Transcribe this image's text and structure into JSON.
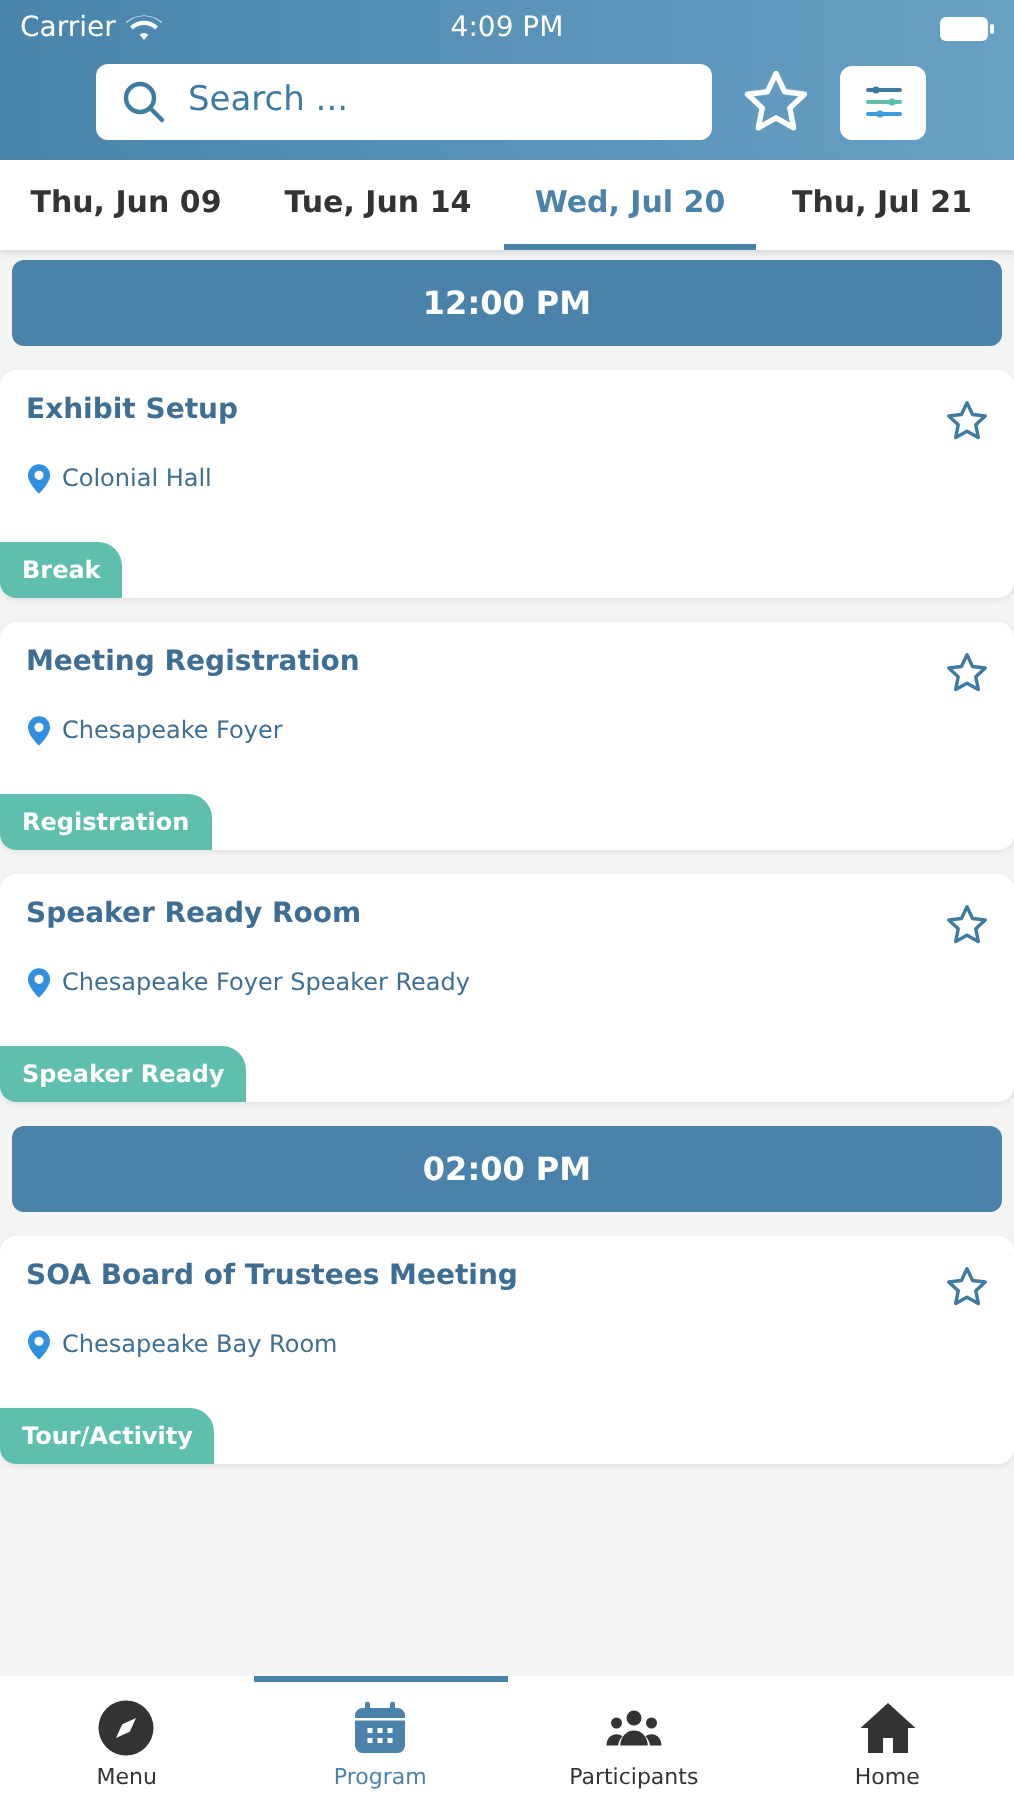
{
  "status_bar": {
    "carrier": "Carrier",
    "time": "4:09 PM"
  },
  "search": {
    "placeholder": "Search ..."
  },
  "tabs": [
    {
      "label": "Thu, Jun 09",
      "selected": false
    },
    {
      "label": "Tue, Jun 14",
      "selected": false
    },
    {
      "label": "Wed, Jul 20",
      "selected": true
    },
    {
      "label": "Thu, Jul 21",
      "selected": false
    }
  ],
  "sessions": [
    {
      "time": "12:00 PM",
      "events": [
        {
          "title": "Exhibit Setup",
          "location": "Colonial Hall",
          "tag": "Break",
          "favorite": false
        },
        {
          "title": "Meeting Registration",
          "location": "Chesapeake Foyer",
          "tag": "Registration",
          "favorite": false
        },
        {
          "title": "Speaker Ready Room",
          "location": "Chesapeake Foyer Speaker Ready",
          "tag": "Speaker Ready",
          "favorite": false
        }
      ]
    },
    {
      "time": "02:00 PM",
      "events": [
        {
          "title": "SOA Board of Trustees Meeting",
          "location": "Chesapeake Bay Room",
          "tag": "Tour/Activity",
          "favorite": false
        }
      ]
    }
  ],
  "bottom_nav": [
    {
      "label": "Menu",
      "kind": "compass",
      "selected": false
    },
    {
      "label": "Program",
      "kind": "calendar",
      "selected": true
    },
    {
      "label": "Participants",
      "kind": "people",
      "selected": false
    },
    {
      "label": "Home",
      "kind": "home",
      "selected": false
    }
  ]
}
